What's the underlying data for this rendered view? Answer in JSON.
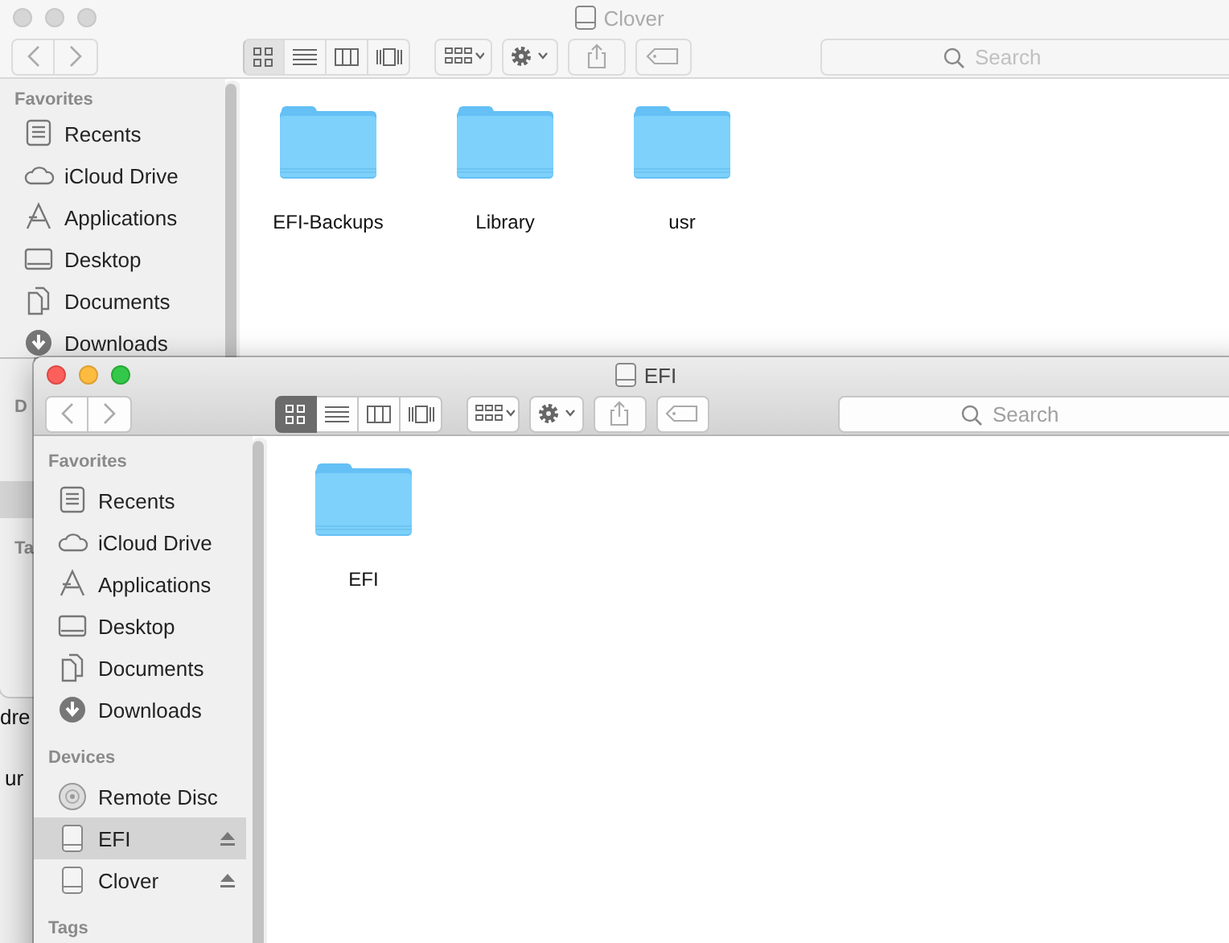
{
  "behind_window": {
    "texts": [
      "dre",
      "ur"
    ]
  },
  "windows": [
    {
      "title": "Clover",
      "active": false,
      "toolbar": {
        "view_modes": [
          {
            "kind": "icons",
            "selected": true
          },
          {
            "kind": "list",
            "selected": false
          },
          {
            "kind": "columns",
            "selected": false
          },
          {
            "kind": "coverflow",
            "selected": false
          }
        ],
        "search": {
          "placeholder": "Search"
        }
      },
      "sidebar": {
        "sections": [
          {
            "heading": "Favorites",
            "items": [
              {
                "kind": "recents",
                "label": "Recents",
                "selected": false
              },
              {
                "kind": "icloud",
                "label": "iCloud Drive",
                "selected": false
              },
              {
                "kind": "applications",
                "label": "Applications",
                "selected": false
              },
              {
                "kind": "desktop",
                "label": "Desktop",
                "selected": false
              },
              {
                "kind": "documents",
                "label": "Documents",
                "selected": false
              },
              {
                "kind": "downloads",
                "label": "Downloads",
                "selected": false
              }
            ]
          }
        ]
      },
      "sidebar_strip": {
        "sections": [
          {
            "heading": "D",
            "items": [
              {
                "selected": true
              }
            ]
          },
          {
            "heading": "Ta"
          }
        ]
      },
      "files": [
        {
          "name": "EFI-Backups"
        },
        {
          "name": "Library"
        },
        {
          "name": "usr"
        }
      ]
    },
    {
      "title": "EFI",
      "active": true,
      "toolbar": {
        "view_modes": [
          {
            "kind": "icons",
            "selected": true
          },
          {
            "kind": "list",
            "selected": false
          },
          {
            "kind": "columns",
            "selected": false
          },
          {
            "kind": "coverflow",
            "selected": false
          }
        ],
        "search": {
          "placeholder": "Search"
        }
      },
      "sidebar": {
        "sections": [
          {
            "heading": "Favorites",
            "items": [
              {
                "kind": "recents",
                "label": "Recents",
                "selected": false
              },
              {
                "kind": "icloud",
                "label": "iCloud Drive",
                "selected": false
              },
              {
                "kind": "applications",
                "label": "Applications",
                "selected": false
              },
              {
                "kind": "desktop",
                "label": "Desktop",
                "selected": false
              },
              {
                "kind": "documents",
                "label": "Documents",
                "selected": false
              },
              {
                "kind": "downloads",
                "label": "Downloads",
                "selected": false
              }
            ]
          },
          {
            "heading": "Devices",
            "items": [
              {
                "kind": "disc",
                "label": "Remote Disc",
                "selected": false
              },
              {
                "kind": "drive",
                "label": "EFI",
                "selected": true,
                "eject": true
              },
              {
                "kind": "drive",
                "label": "Clover",
                "selected": false,
                "eject": true
              }
            ]
          },
          {
            "heading": "Tags"
          }
        ]
      },
      "files": [
        {
          "name": "EFI"
        }
      ]
    }
  ]
}
